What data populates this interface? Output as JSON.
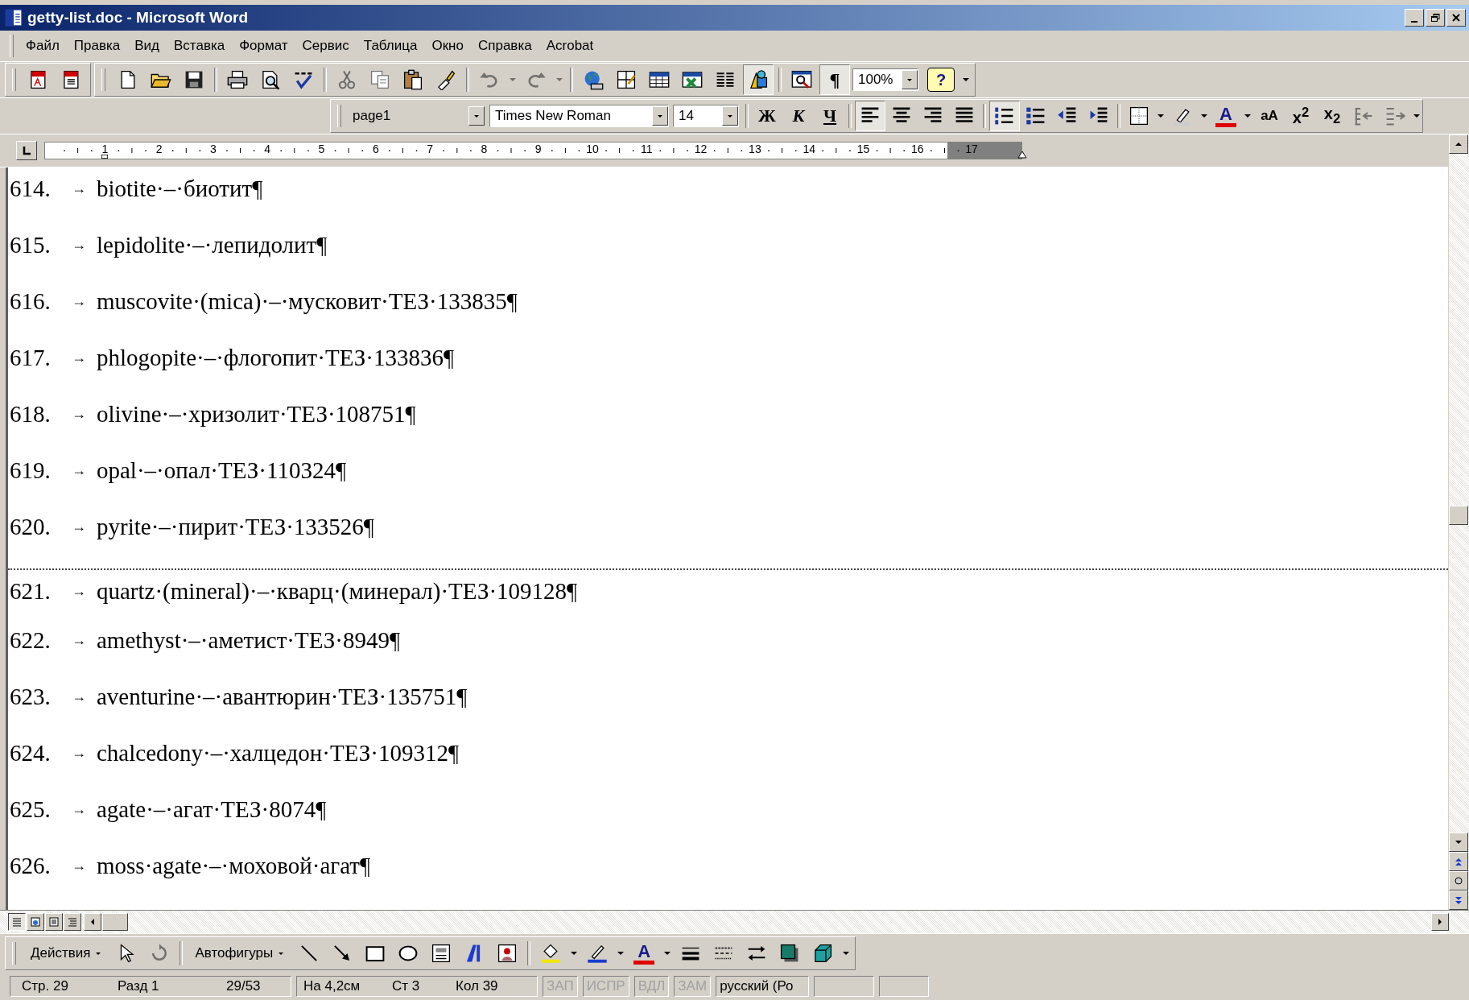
{
  "window": {
    "title": "getty-list.doc - Microsoft Word"
  },
  "menu": [
    {
      "label": "Файл"
    },
    {
      "label": "Правка"
    },
    {
      "label": "Вид"
    },
    {
      "label": "Вставка"
    },
    {
      "label": "Формат"
    },
    {
      "label": "Сервис"
    },
    {
      "label": "Таблица"
    },
    {
      "label": "Окно"
    },
    {
      "label": "Справка"
    },
    {
      "label": "Acrobat"
    }
  ],
  "toolbar_row_1": [
    {
      "groups": [
        [
          {
            "kind": "pdf",
            "pressed": false,
            "disabled": false
          },
          {
            "kind": "pdf2",
            "pressed": false,
            "disabled": false
          }
        ]
      ]
    },
    {
      "groups": [
        [
          {
            "kind": "new",
            "pressed": false,
            "disabled": false
          },
          {
            "kind": "open",
            "pressed": false,
            "disabled": false
          },
          {
            "kind": "save",
            "pressed": false,
            "disabled": false
          }
        ],
        [
          {
            "kind": "print",
            "pressed": false,
            "disabled": false
          },
          {
            "kind": "preview",
            "pressed": false,
            "disabled": false
          },
          {
            "kind": "spelling",
            "pressed": false,
            "disabled": false
          }
        ],
        [
          {
            "kind": "cut",
            "pressed": false,
            "disabled": false
          },
          {
            "kind": "copy",
            "pressed": false,
            "disabled": false
          },
          {
            "kind": "paste",
            "pressed": false,
            "disabled": false
          },
          {
            "kind": "painter",
            "pressed": false,
            "disabled": false
          }
        ],
        [
          {
            "kind": "undo",
            "pressed": false,
            "disabled": true
          },
          {
            "kind": "dropdown",
            "pressed": false,
            "disabled": true
          },
          {
            "kind": "redo",
            "pressed": false,
            "disabled": true
          },
          {
            "kind": "dropdown",
            "pressed": false,
            "disabled": true
          }
        ],
        [
          {
            "kind": "web",
            "pressed": false,
            "disabled": false
          },
          {
            "kind": "tables_borders",
            "pressed": false,
            "disabled": false
          },
          {
            "kind": "table",
            "pressed": false,
            "disabled": false
          },
          {
            "kind": "excel",
            "pressed": false,
            "disabled": false
          },
          {
            "kind": "columns",
            "pressed": false,
            "disabled": false
          },
          {
            "kind": "drawing",
            "pressed": true,
            "disabled": false
          }
        ],
        [
          {
            "kind": "docmap",
            "pressed": false,
            "disabled": false
          },
          {
            "kind": "pilcrow",
            "label": "¶",
            "pressed": true,
            "disabled": false
          },
          {
            "kind": "zoom_combo",
            "value": "100%"
          },
          {
            "kind": "help",
            "label": "?",
            "pressed": false,
            "disabled": false
          },
          {
            "kind": "overflow",
            "pressed": false,
            "disabled": false
          }
        ]
      ]
    }
  ],
  "toolbar_row_2": [
    {
      "groups": [
        [
          {
            "kind": "style_combo",
            "value": "page1"
          },
          {
            "kind": "font_combo",
            "value": "Times New Roman"
          },
          {
            "kind": "size_combo",
            "value": "14"
          }
        ],
        [
          {
            "kind": "bold",
            "label": "Ж",
            "pressed": false,
            "disabled": false
          },
          {
            "kind": "italic",
            "label": "К",
            "pressed": false,
            "disabled": false
          },
          {
            "kind": "underline",
            "label": "Ч",
            "pressed": false,
            "disabled": false
          }
        ],
        [
          {
            "kind": "align_left",
            "pressed": true,
            "disabled": false
          },
          {
            "kind": "align_center",
            "pressed": false,
            "disabled": false
          },
          {
            "kind": "align_right",
            "pressed": false,
            "disabled": false
          },
          {
            "kind": "justify",
            "pressed": false,
            "disabled": false
          }
        ],
        [
          {
            "kind": "numbering",
            "pressed": true,
            "disabled": false
          },
          {
            "kind": "bullets",
            "pressed": false,
            "disabled": false
          },
          {
            "kind": "outdent",
            "pressed": false,
            "disabled": false
          },
          {
            "kind": "indent",
            "pressed": false,
            "disabled": false
          }
        ],
        [
          {
            "kind": "border",
            "pressed": false,
            "disabled": false
          },
          {
            "kind": "dropdown",
            "pressed": false,
            "disabled": false
          },
          {
            "kind": "highlight",
            "pressed": false,
            "disabled": false
          },
          {
            "kind": "dropdown",
            "pressed": false,
            "disabled": false
          },
          {
            "kind": "fontcolor",
            "label": "A",
            "pressed": false,
            "disabled": false
          },
          {
            "kind": "dropdown",
            "pressed": false,
            "disabled": false
          },
          {
            "kind": "case",
            "label": "aA",
            "pressed": false,
            "disabled": false
          },
          {
            "kind": "superscript",
            "label": "x$^{2}$",
            "pressed": false,
            "disabled": false
          },
          {
            "kind": "subscript",
            "label": "x$_{2}$",
            "pressed": false,
            "disabled": false
          },
          {
            "kind": "split",
            "pressed": false,
            "disabled": true
          },
          {
            "kind": "merge",
            "pressed": false,
            "disabled": true
          },
          {
            "kind": "overflow",
            "pressed": false,
            "disabled": false
          }
        ]
      ]
    }
  ],
  "ruler": {
    "numbers": [
      "1",
      "2",
      "3",
      "4",
      "5",
      "6",
      "7",
      "8",
      "9",
      "10",
      "11",
      "12",
      "13",
      "14",
      "15",
      "16",
      "17"
    ]
  },
  "document": {
    "lines": [
      {
        "number": "614.",
        "tab_mark": "→",
        "text": "biotite·–·биотит¶",
        "page_break_before": false
      },
      {
        "number": "615.",
        "tab_mark": "→",
        "text": "lepidolite·–·лепидолит¶",
        "page_break_before": false
      },
      {
        "number": "616.",
        "tab_mark": "→",
        "text": "muscovite·(mica)·–·мусковит·ТЕЗ·133835¶",
        "page_break_before": false
      },
      {
        "number": "617.",
        "tab_mark": "→",
        "text": "phlogopite·–·флогопит·ТЕЗ·133836¶",
        "page_break_before": false
      },
      {
        "number": "618.",
        "tab_mark": "→",
        "text": "olivine·–·хризолит·ТЕЗ·108751¶",
        "page_break_before": false
      },
      {
        "number": "619.",
        "tab_mark": "→",
        "text": "opal·–·опал·ТЕЗ·110324¶",
        "page_break_before": false
      },
      {
        "number": "620.",
        "tab_mark": "→",
        "text": "pyrite·–·пирит·ТЕЗ·133526¶",
        "page_break_before": false
      },
      {
        "number": "621.",
        "tab_mark": "→",
        "text": "quartz·(mineral)·–·кварц·(минерал)·ТЕЗ·109128¶",
        "page_break_before": true
      },
      {
        "number": "622.",
        "tab_mark": "→",
        "text": "amethyst·–·аметист·ТЕЗ·8949¶",
        "page_break_before": false
      },
      {
        "number": "623.",
        "tab_mark": "→",
        "text": "aventurine·–·авантюрин·ТЕЗ·135751¶",
        "page_break_before": false
      },
      {
        "number": "624.",
        "tab_mark": "→",
        "text": "chalcedony·–·халцедон·ТЕЗ·109312¶",
        "page_break_before": false
      },
      {
        "number": "625.",
        "tab_mark": "→",
        "text": "agate·–·агат·ТЕЗ·8074¶",
        "page_break_before": false
      },
      {
        "number": "626.",
        "tab_mark": "→",
        "text": "moss·agate·–·моховой·агат¶",
        "page_break_before": false
      }
    ]
  },
  "view_buttons": [
    {
      "kind": "normal",
      "selected": true
    },
    {
      "kind": "web",
      "selected": false
    },
    {
      "kind": "print",
      "selected": false
    },
    {
      "kind": "outline",
      "selected": false
    }
  ],
  "drawing_toolbar": {
    "groups": [
      [
        {
          "kind": "menu",
          "label": "Действия",
          "pressed": false,
          "disabled": false
        },
        {
          "kind": "pointer",
          "pressed": false,
          "disabled": false
        },
        {
          "kind": "rotate",
          "pressed": false,
          "disabled": true
        }
      ],
      [
        {
          "kind": "menu",
          "label": "Автофигуры",
          "pressed": false,
          "disabled": false
        },
        {
          "kind": "line",
          "pressed": false,
          "disabled": false
        },
        {
          "kind": "arrow",
          "pressed": false,
          "disabled": false
        },
        {
          "kind": "rect",
          "pressed": false,
          "disabled": false
        },
        {
          "kind": "oval",
          "pressed": false,
          "disabled": false
        },
        {
          "kind": "textbox",
          "pressed": false,
          "disabled": false
        },
        {
          "kind": "wordart",
          "pressed": false,
          "disabled": false
        },
        {
          "kind": "clipart",
          "pressed": false,
          "disabled": false
        }
      ],
      [
        {
          "kind": "fill",
          "pressed": false,
          "disabled": false
        },
        {
          "kind": "dropdown",
          "pressed": false,
          "disabled": false
        },
        {
          "kind": "linecolor",
          "pressed": false,
          "disabled": false
        },
        {
          "kind": "dropdown",
          "pressed": false,
          "disabled": false
        },
        {
          "kind": "fontcolor",
          "label": "A",
          "pressed": false,
          "disabled": false
        },
        {
          "kind": "dropdown",
          "pressed": false,
          "disabled": false
        },
        {
          "kind": "linestyle",
          "pressed": false,
          "disabled": false
        },
        {
          "kind": "dashstyle",
          "pressed": false,
          "disabled": false
        },
        {
          "kind": "arrowstyle",
          "pressed": false,
          "disabled": false
        },
        {
          "kind": "shadow",
          "pressed": false,
          "disabled": false
        },
        {
          "kind": "cube",
          "pressed": false,
          "disabled": false
        },
        {
          "kind": "overflow",
          "pressed": false,
          "disabled": false
        }
      ]
    ]
  },
  "status_bar": {
    "panels": [
      [
        "Стр. 29",
        "Разд 1",
        "29/53"
      ],
      [
        "На 4,2см",
        "Ст 3",
        "Кол 39"
      ]
    ],
    "modes": [
      {
        "label": "ЗАП",
        "on": false
      },
      {
        "label": "ИСПР",
        "on": false
      },
      {
        "label": "ВДЛ",
        "on": false
      },
      {
        "label": "ЗАМ",
        "on": false
      }
    ],
    "language": "русский (Ро"
  }
}
